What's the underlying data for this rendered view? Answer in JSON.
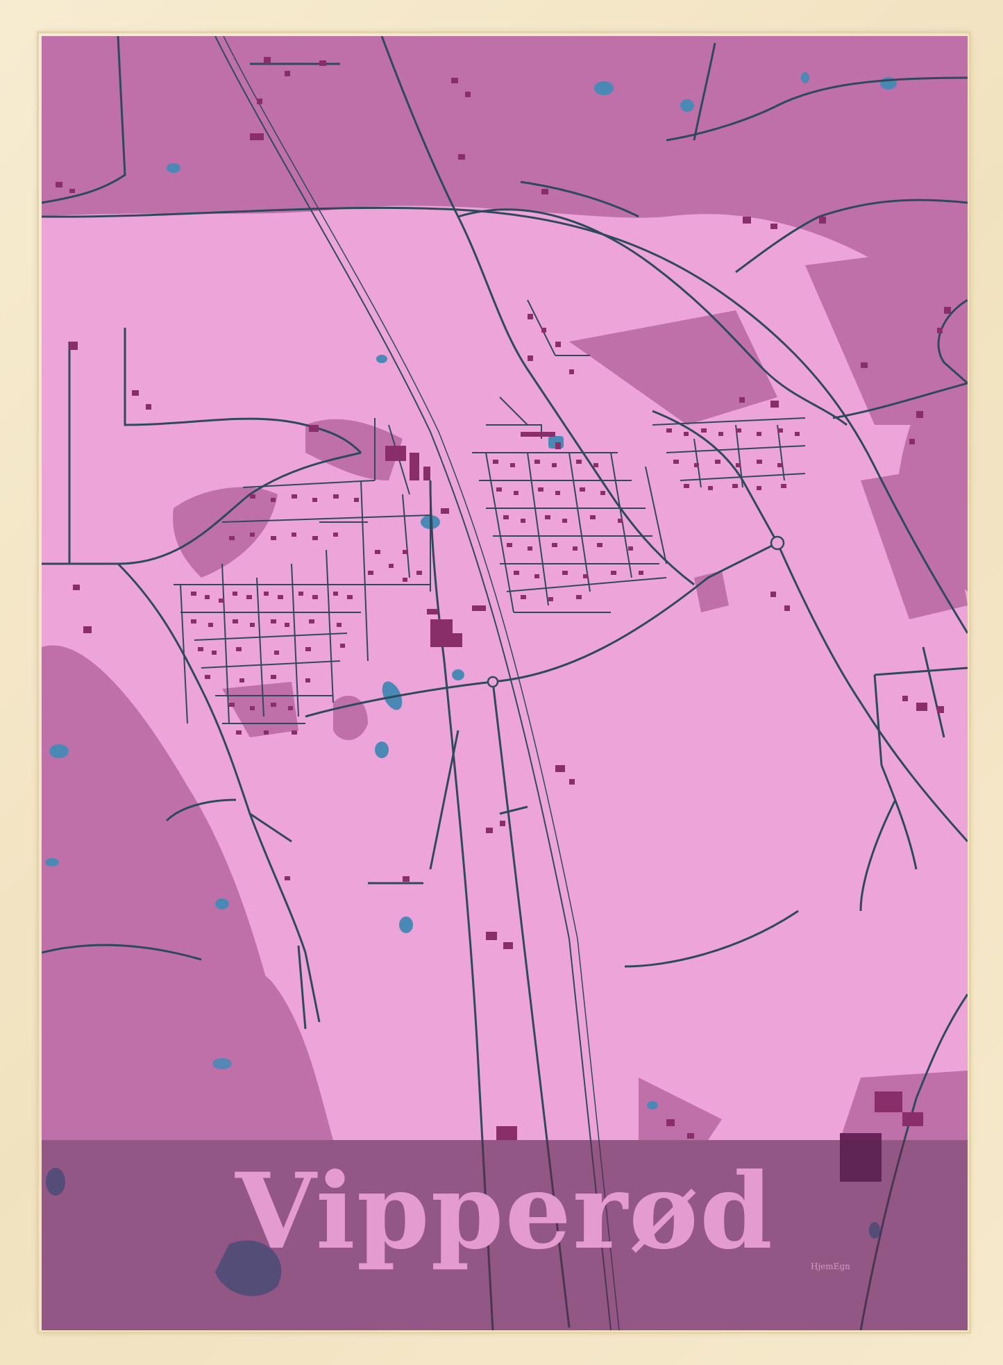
{
  "poster": {
    "title": "Vipperød",
    "brand": "HjemEgn"
  },
  "colors": {
    "frame": "#f4e7c9",
    "land_light": "#eda4d9",
    "land_dark": "#bf70a8",
    "roads": "#2e4a5a",
    "buildings": "#8a2e6a",
    "water": "#4a89b5",
    "title_band": "#5a2850",
    "title_text": "#e39bd0"
  },
  "icons": {
    "roundabout-west": "circle",
    "roundabout-east": "circle"
  }
}
